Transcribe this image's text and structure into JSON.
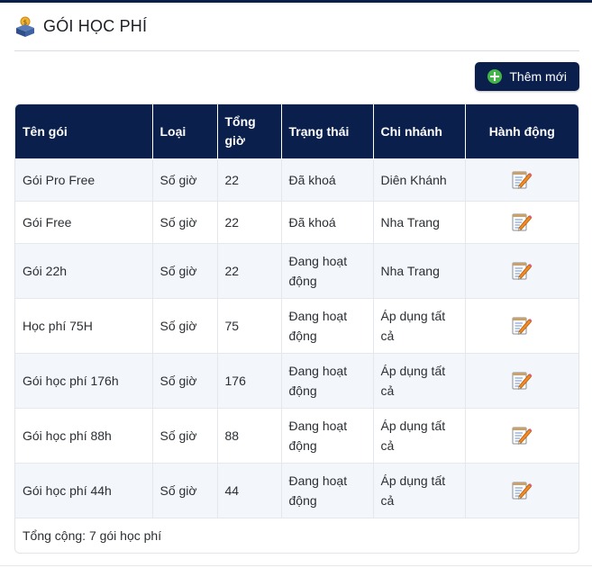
{
  "header": {
    "title": "GÓI HỌC PHÍ",
    "icon": "money-box-icon"
  },
  "toolbar": {
    "add_label": "Thêm mới",
    "add_icon": "plus-circle-icon",
    "accent": "#0b1f4d"
  },
  "table": {
    "columns": [
      "Tên gói",
      "Loại",
      "Tổng giờ",
      "Trạng thái",
      "Chi nhánh",
      "Hành động"
    ],
    "rows": [
      {
        "name": "Gói Pro Free",
        "type": "Số giờ",
        "hours": "22",
        "status": "Đã khoá",
        "branch": "Diên Khánh"
      },
      {
        "name": "Gói Free",
        "type": "Số giờ",
        "hours": "22",
        "status": "Đã khoá",
        "branch": "Nha Trang"
      },
      {
        "name": "Gói 22h",
        "type": "Số giờ",
        "hours": "22",
        "status": "Đang hoạt động",
        "branch": "Nha Trang"
      },
      {
        "name": "Học phí 75H",
        "type": "Số giờ",
        "hours": "75",
        "status": "Đang hoạt động",
        "branch": "Áp dụng tất cả"
      },
      {
        "name": "Gói học phí 176h",
        "type": "Số giờ",
        "hours": "176",
        "status": "Đang hoạt động",
        "branch": "Áp dụng tất cả"
      },
      {
        "name": "Gói học phí 88h",
        "type": "Số giờ",
        "hours": "88",
        "status": "Đang hoạt động",
        "branch": "Áp dụng tất cả"
      },
      {
        "name": "Gói học phí 44h",
        "type": "Số giờ",
        "hours": "44",
        "status": "Đang hoạt động",
        "branch": "Áp dụng tất cả"
      }
    ],
    "action_icon": "edit-pencil-icon"
  },
  "footer": {
    "total_text": "Tổng cộng: 7 gói học phí"
  }
}
